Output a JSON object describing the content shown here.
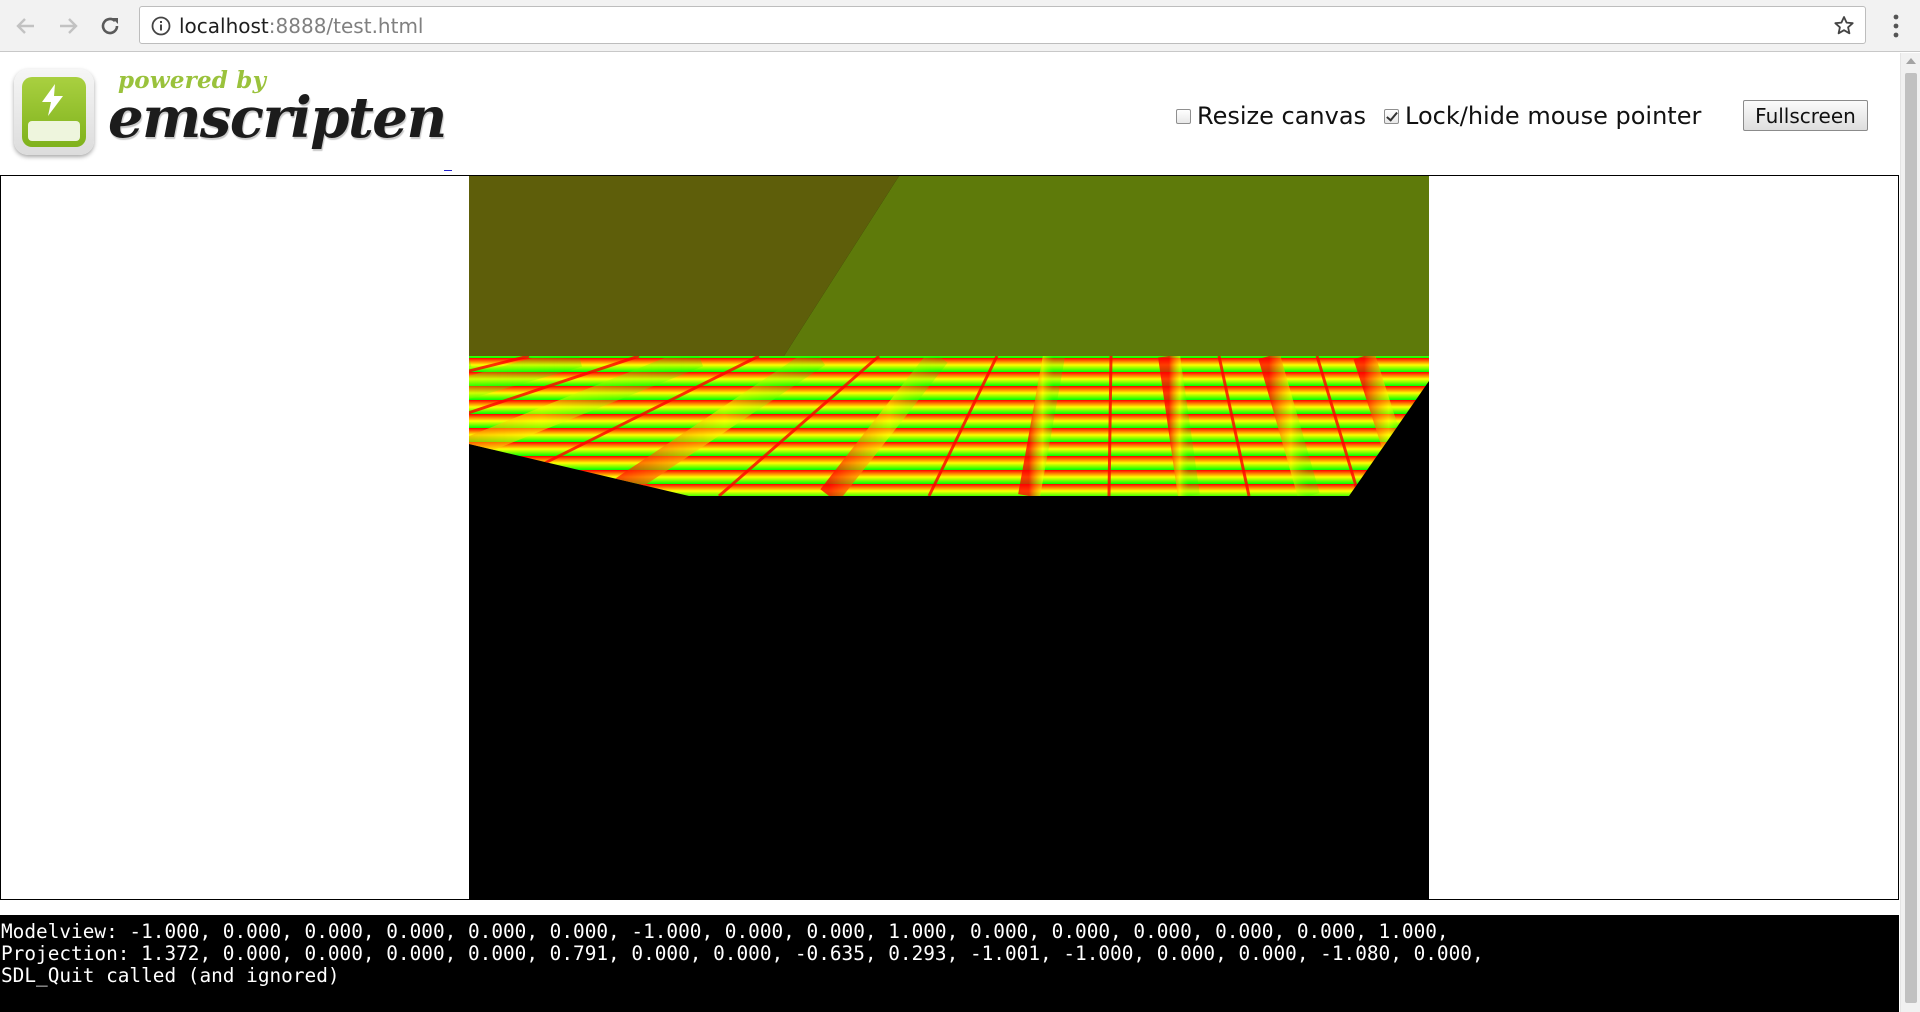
{
  "browser": {
    "url_host": "localhost",
    "url_rest": ":8888/test.html",
    "icons": {
      "back": "arrow-left",
      "forward": "arrow-right",
      "reload": "reload",
      "site_info": "info-circle",
      "bookmark": "star-outline",
      "menu": "three-dots-vertical"
    }
  },
  "logo": {
    "tagline": "powered by",
    "wordmark": "emscripten",
    "accent_color": "#9ac23c"
  },
  "controls": {
    "resize_canvas": {
      "label": "Resize canvas",
      "checked": false
    },
    "lock_pointer": {
      "label": "Lock/hide mouse pointer",
      "checked": true
    },
    "fullscreen_label": "Fullscreen"
  },
  "scene": {
    "sky_left_color": "#5e5e0a",
    "sky_right_color": "#5e7a0a",
    "floor_colors": [
      "#ff0000",
      "#00ff00",
      "#ffff00"
    ],
    "background": "#000000"
  },
  "console": {
    "lines": [
      "Modelview: -1.000, 0.000, 0.000, 0.000, 0.000, 0.000, -1.000, 0.000, 0.000, 1.000, 0.000, 0.000, 0.000, 0.000, 0.000, 1.000,",
      "Projection: 1.372, 0.000, 0.000, 0.000, 0.000, 0.791, 0.000, 0.000, -0.635, 0.293, -1.001, -1.000, 0.000, 0.000, -1.080, 0.000,",
      "SDL_Quit called (and ignored)"
    ]
  }
}
